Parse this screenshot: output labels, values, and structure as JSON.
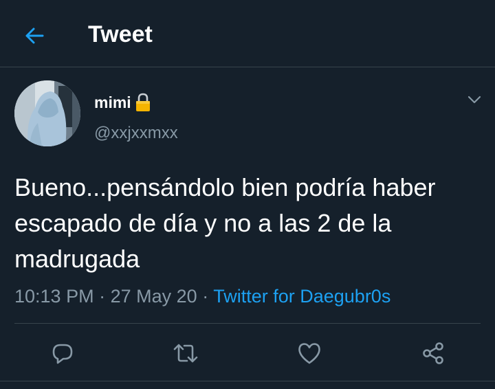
{
  "header": {
    "title": "Tweet",
    "back_icon": "arrow-left-icon"
  },
  "author": {
    "display_name": "mimi",
    "handle": "@xxjxxmxx",
    "protected_icon": "lock-icon"
  },
  "tweet": {
    "text": "Bueno...pensándolo bien podría haber escapado de día y no a las 2 de la madrugada",
    "time": "10:13 PM",
    "separator": "·",
    "date": "27 May 20",
    "source": "Twitter for Daegubr0s"
  },
  "actions": [
    {
      "name": "reply",
      "icon": "reply-icon"
    },
    {
      "name": "retweet",
      "icon": "retweet-icon"
    },
    {
      "name": "like",
      "icon": "heart-icon"
    },
    {
      "name": "share",
      "icon": "share-icon"
    }
  ],
  "colors": {
    "background": "#15202b",
    "accent": "#1da1f2",
    "secondary_text": "#8899a6",
    "divider": "#38444d",
    "lock": "#f5b400"
  }
}
